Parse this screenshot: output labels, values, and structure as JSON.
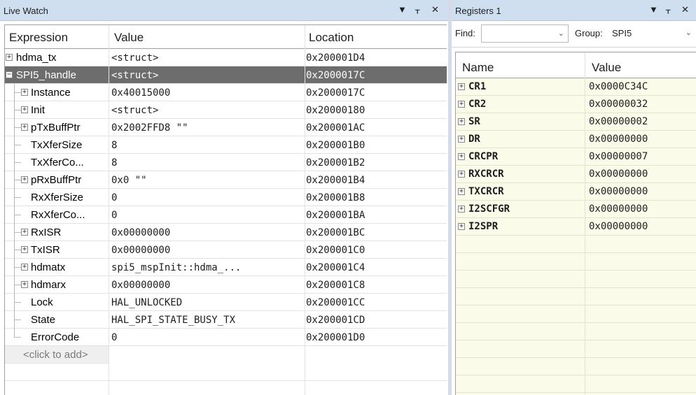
{
  "live_watch": {
    "title": "Live Watch",
    "controls": {
      "dropdown": "▼",
      "pin": "⊥",
      "close": "✕"
    },
    "columns": {
      "expression": "Expression",
      "value": "Value",
      "location": "Location"
    },
    "rows": [
      {
        "expr": "hdma_tx",
        "value": "<struct>",
        "location": "0x200001D4",
        "expander": "+",
        "level": 0
      },
      {
        "expr": "SPI5_handle",
        "value": "<struct>",
        "location": "0x2000017C",
        "expander": "-",
        "level": 0,
        "selected": true
      },
      {
        "expr": "Instance",
        "value": "0x40015000",
        "location": "0x2000017C",
        "expander": "+",
        "level": 1
      },
      {
        "expr": "Init",
        "value": "<struct>",
        "location": "0x20000180",
        "expander": "+",
        "level": 1
      },
      {
        "expr": "pTxBuffPtr",
        "value": "0x2002FFD8 \"\"",
        "location": "0x200001AC",
        "expander": "+",
        "level": 1
      },
      {
        "expr": "TxXferSize",
        "value": "8",
        "location": "0x200001B0",
        "expander": "",
        "level": 1
      },
      {
        "expr": "TxXferCo...",
        "value": "8",
        "location": "0x200001B2",
        "expander": "",
        "level": 1
      },
      {
        "expr": "pRxBuffPtr",
        "value": "0x0 \"\"",
        "location": "0x200001B4",
        "expander": "+",
        "level": 1
      },
      {
        "expr": "RxXferSize",
        "value": "0",
        "location": "0x200001B8",
        "expander": "",
        "level": 1
      },
      {
        "expr": "RxXferCo...",
        "value": "0",
        "location": "0x200001BA",
        "expander": "",
        "level": 1
      },
      {
        "expr": "RxISR",
        "value": "0x00000000",
        "location": "0x200001BC",
        "expander": "+",
        "level": 1
      },
      {
        "expr": "TxISR",
        "value": "0x00000000",
        "location": "0x200001C0",
        "expander": "+",
        "level": 1
      },
      {
        "expr": "hdmatx",
        "value": "spi5_mspInit::hdma_...",
        "location": "0x200001C4",
        "expander": "+",
        "level": 1
      },
      {
        "expr": "hdmarx",
        "value": "0x00000000",
        "location": "0x200001C8",
        "expander": "+",
        "level": 1
      },
      {
        "expr": "Lock",
        "value": "HAL_UNLOCKED",
        "location": "0x200001CC",
        "expander": "",
        "level": 1
      },
      {
        "expr": "State",
        "value": "HAL_SPI_STATE_BUSY_TX",
        "location": "0x200001CD",
        "expander": "",
        "level": 1
      },
      {
        "expr": "ErrorCode",
        "value": "0",
        "location": "0x200001D0",
        "expander": "",
        "level": 1
      }
    ],
    "add_row_label": "<click to add>"
  },
  "registers": {
    "title": "Registers 1",
    "controls": {
      "dropdown": "▼",
      "pin": "⊥",
      "close": "✕"
    },
    "find_label": "Find:",
    "find_value": "",
    "group_label": "Group:",
    "group_value": "SPI5",
    "columns": {
      "name": "Name",
      "value": "Value"
    },
    "rows": [
      {
        "name": "CR1",
        "value": "0x0000C34C"
      },
      {
        "name": "CR2",
        "value": "0x00000032"
      },
      {
        "name": "SR",
        "value": "0x00000002"
      },
      {
        "name": "DR",
        "value": "0x00000000"
      },
      {
        "name": "CRCPR",
        "value": "0x00000007"
      },
      {
        "name": "RXCRCR",
        "value": "0x00000000"
      },
      {
        "name": "TXCRCR",
        "value": "0x00000000"
      },
      {
        "name": "I2SCFGR",
        "value": "0x00000000"
      },
      {
        "name": "I2SPR",
        "value": "0x00000000"
      }
    ]
  },
  "colors": {
    "titlebar": "#cfdff0",
    "selected_row": "#6d6d6d",
    "register_background": "#fbfbea"
  }
}
